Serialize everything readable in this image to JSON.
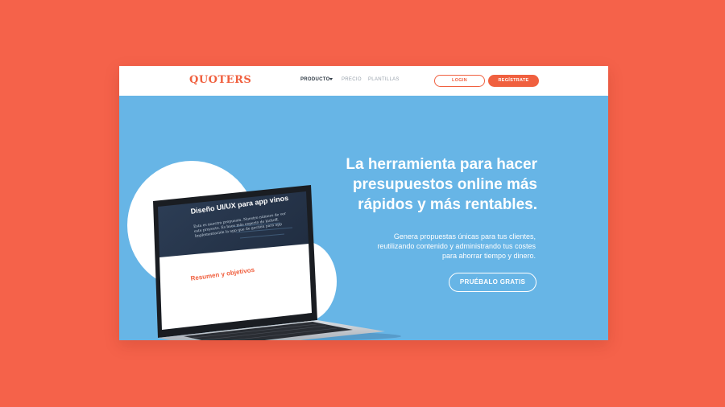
{
  "header": {
    "logo": "QUOTERS",
    "nav": [
      {
        "label": "PRODUCTO"
      },
      {
        "label": "PRECIO"
      },
      {
        "label": "PLANTILLAS"
      }
    ],
    "login_label": "LOGIN",
    "register_label": "REGÍSTRATE"
  },
  "hero": {
    "title_line1": "La herramienta para hacer",
    "title_line2": "presupuestos online más",
    "title_line3": "rápidos y más rentables.",
    "subtitle_line1": "Genera propuestas únicas para tus clientes,",
    "subtitle_line2": "reutilizando contenido y administrando tus costes",
    "subtitle_line3": "para ahorrar tiempo y dinero.",
    "cta_label": "PRUÉBALO GRATIS"
  },
  "laptop_screen": {
    "title": "Diseño UI/UX para app vinos",
    "text": "Esta es nuestra propuesta. Nuestro número de ver este proyecto. Es hace más experto de kickoff. Implementación la app que de gestión para app",
    "section_heading": "Resumen y objetivos"
  },
  "colors": {
    "background": "#f5624a",
    "hero": "#67b5e6",
    "accent": "#f0603f"
  }
}
